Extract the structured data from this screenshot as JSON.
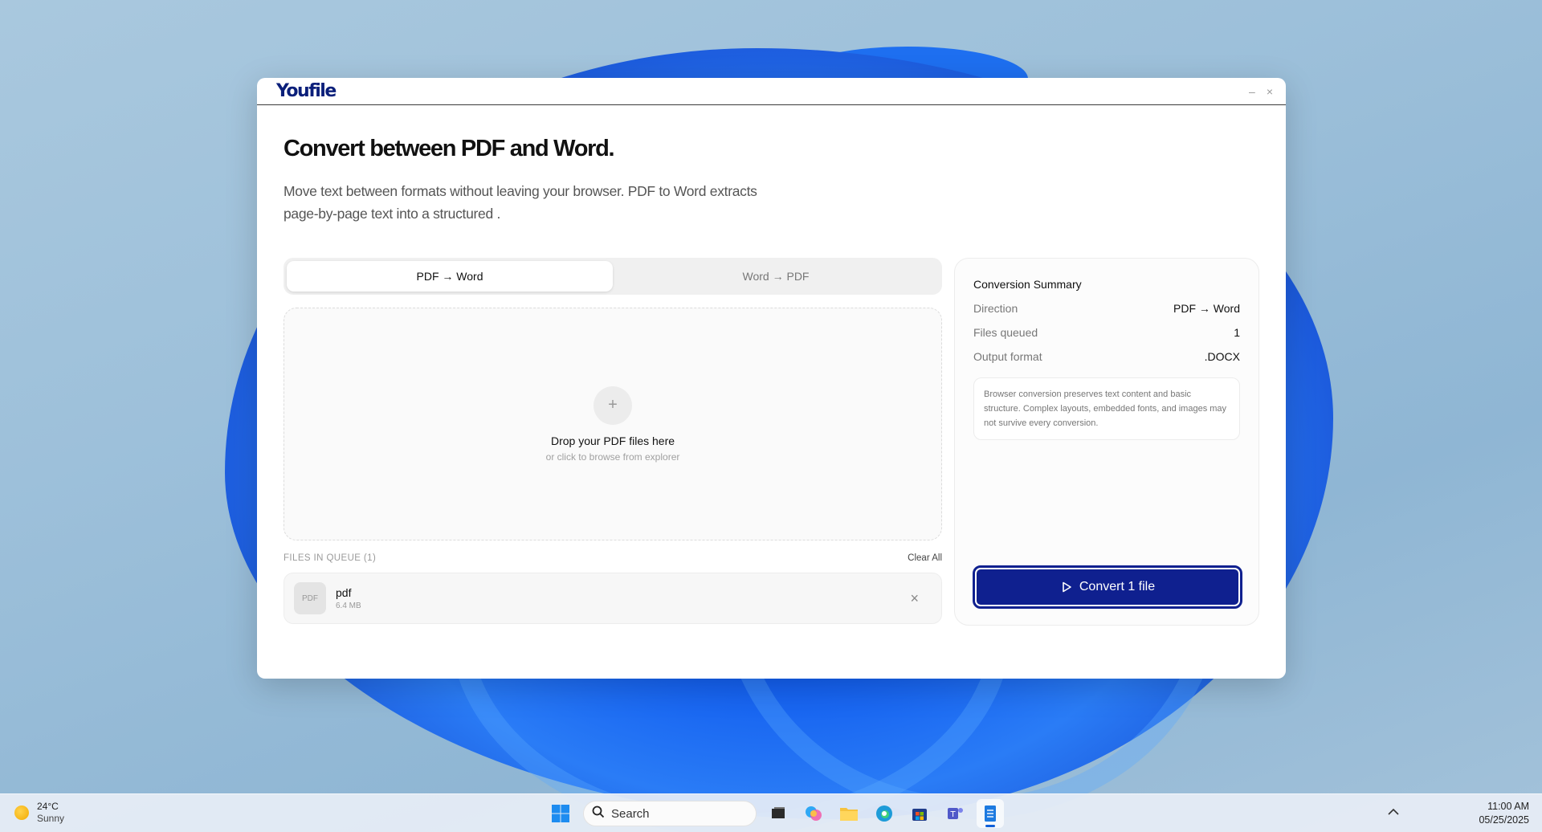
{
  "window": {
    "logo": "Youfile",
    "minimize_glyph": "–",
    "close_glyph": "×"
  },
  "header": {
    "title": "Convert between PDF and Word.",
    "description_line1": "Move text between formats without leaving your browser. PDF to Word extracts",
    "description_line2": "page-by-page text into a structured ."
  },
  "tabs": [
    {
      "label": "PDF → Word",
      "active": true
    },
    {
      "label": "Word → PDF",
      "active": false
    }
  ],
  "dropzone": {
    "plus_glyph": "+",
    "title": "Drop your PDF files here",
    "subtitle": "or click to browse from explorer"
  },
  "queue": {
    "label": "FILES IN QUEUE (1)",
    "clear_label": "Clear All",
    "files": [
      {
        "thumb": "PDF",
        "name": "pdf",
        "size": "6.4 MB",
        "remove_glyph": "×"
      }
    ]
  },
  "summary": {
    "title": "Conversion Summary",
    "rows": [
      {
        "key": "Direction",
        "value": "PDF → Word"
      },
      {
        "key": "Files queued",
        "value": "1"
      },
      {
        "key": "Output format",
        "value": ".DOCX"
      }
    ],
    "note": "Browser conversion preserves text content and basic structure. Complex layouts, embedded fonts, and images may not survive every conversion.",
    "convert_label": "Convert 1 file"
  },
  "taskbar": {
    "weather_temp": "24°C",
    "weather_condition": "Sunny",
    "search_placeholder": "Search",
    "time": "11:00 AM",
    "date": "05/25/2025",
    "icons": [
      "windows-start-icon",
      "search-icon",
      "task-view-icon",
      "copilot-icon",
      "file-explorer-icon",
      "edge-icon",
      "microsoft-store-icon",
      "teams-icon",
      "notepad-icon"
    ]
  },
  "colors": {
    "brand_navy": "#0f208f",
    "logo": "#0b1f7a"
  }
}
